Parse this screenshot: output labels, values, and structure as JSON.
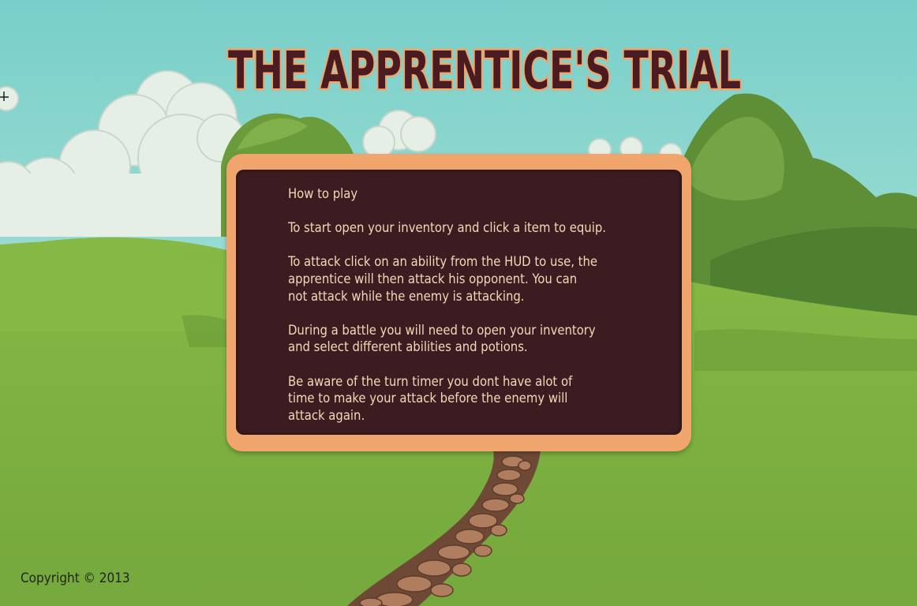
{
  "title": "THE APPRENTICE'S TRIAL",
  "instructions": {
    "heading": "How to play",
    "paragraphs": [
      "To start open your inventory and click a item to equip.",
      "To attack click on an ability from the HUD to use, the\napprentice will then attack his opponent. You can\nnot attack while the enemy is attacking.",
      "During a battle you will need to open your inventory\nand select different abilities and potions.",
      "Be aware of the turn timer you dont have alot of\ntime to make your attack before the enemy will\nattack again."
    ]
  },
  "copyright": "Copyright © 2013",
  "colors": {
    "sky": "#7fd0c8",
    "grass": "#7aaa42",
    "board_frame": "#f0a56c",
    "board_panel": "#3d1c21",
    "board_text": "#f2d9b6",
    "title_fill": "#4a1c22",
    "title_outline": "#f0a56c"
  }
}
